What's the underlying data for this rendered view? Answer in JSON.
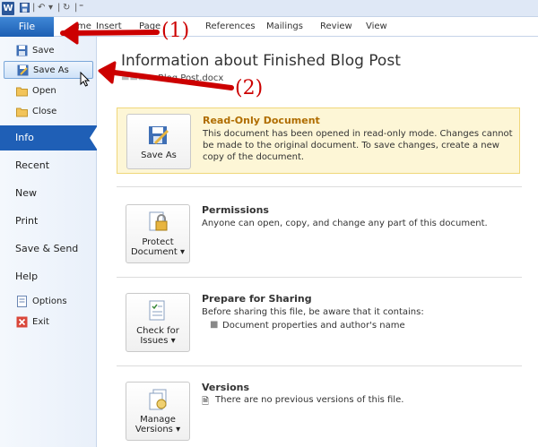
{
  "qat": {
    "app_icon": "W",
    "save_icon": "save-icon",
    "undo_icon": "undo-icon",
    "redo_icon": "redo-icon"
  },
  "ribbon_tabs": [
    "File",
    "Home",
    "Insert",
    "Page",
    "References",
    "Mailings",
    "Review",
    "View"
  ],
  "ribbon_tab_visible": {
    "home": "me",
    "page": "Page"
  },
  "backstage": {
    "commands": [
      "Save",
      "Save As",
      "Open",
      "Close"
    ],
    "nav": [
      "Info",
      "Recent",
      "New",
      "Print",
      "Save & Send",
      "Help"
    ],
    "small": [
      "Options",
      "Exit"
    ]
  },
  "info": {
    "title": "Information about Finished Blog Post",
    "filename_fragment": "Blog Post.docx",
    "readonly": {
      "button": "Save As",
      "title": "Read-Only Document",
      "desc": "This document has been opened in read-only mode. Changes cannot be made to the original document. To save changes, create a new copy of the document."
    },
    "permissions": {
      "button_line1": "Protect",
      "button_line2": "Document",
      "title": "Permissions",
      "desc": "Anyone can open, copy, and change any part of this document."
    },
    "sharing": {
      "button_line1": "Check for",
      "button_line2": "Issues",
      "title": "Prepare for Sharing",
      "desc": "Before sharing this file, be aware that it contains:",
      "item": "Document properties and author's name"
    },
    "versions": {
      "button_line1": "Manage",
      "button_line2": "Versions",
      "title": "Versions",
      "desc": "There are no previous versions of this file."
    }
  },
  "annotations": {
    "one": "(1)",
    "two": "(2)"
  },
  "colors": {
    "accent": "#1f5fb6",
    "arrow": "#cc0000",
    "readonly_bg": "#fdf6d6"
  }
}
